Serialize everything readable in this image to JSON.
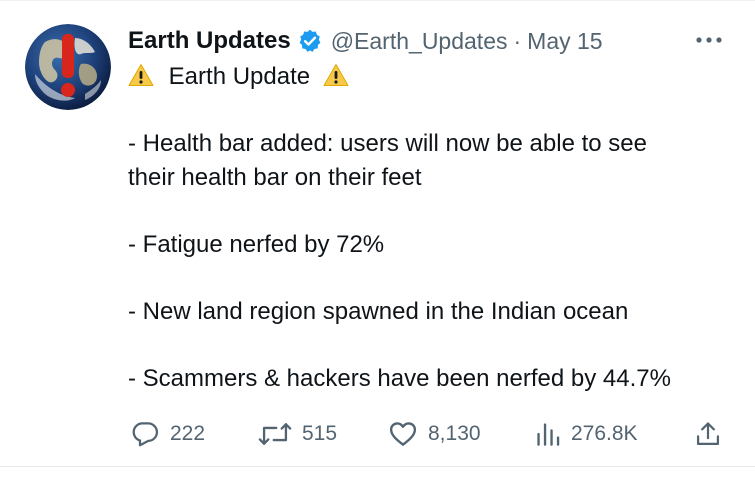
{
  "author": {
    "display_name": "Earth Updates",
    "handle": "@Earth_Updates",
    "separator": "·",
    "date": "May 15"
  },
  "tweet": {
    "heading": "Earth Update",
    "lines": [
      "- Health bar added: users will now be able to see",
      "their health bar on their feet",
      "- Fatigue nerfed by 72%",
      "- New land region spawned in the Indian ocean",
      "- Scammers & hackers have been nerfed by 44.7%"
    ]
  },
  "actions": {
    "replies": "222",
    "reposts": "515",
    "likes": "8,130",
    "views": "276.8K"
  },
  "icons": {
    "verified": "verified-badge-icon",
    "warning": "warning-icon",
    "more": "more-options-icon",
    "reply": "reply-icon",
    "repost": "repost-icon",
    "like": "heart-icon",
    "views": "views-icon",
    "share": "share-icon"
  },
  "colors": {
    "text": "#0f1419",
    "secondary": "#536471",
    "verified": "#1d9bf0",
    "warning": "#f7c948"
  }
}
